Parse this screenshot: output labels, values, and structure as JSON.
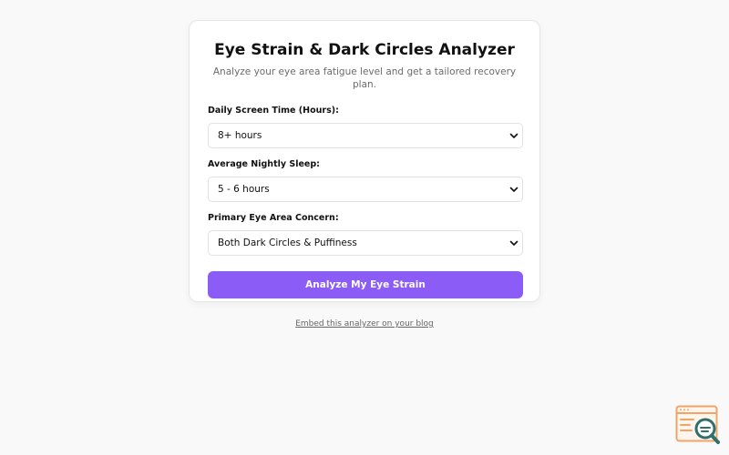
{
  "card": {
    "title": "Eye Strain & Dark Circles Analyzer",
    "subtitle": "Analyze your eye area fatigue level and get a tailored recovery plan."
  },
  "fields": [
    {
      "label": "Daily Screen Time (Hours):",
      "selected": "8+ hours"
    },
    {
      "label": "Average Nightly Sleep:",
      "selected": "5 - 6 hours"
    },
    {
      "label": "Primary Eye Area Concern:",
      "selected": "Both Dark Circles & Puffiness"
    }
  ],
  "submit_label": "Analyze My Eye Strain",
  "embed_link": "Embed this analyzer on your blog",
  "colors": {
    "accent": "#8b5cf6",
    "background": "#f9f9f9",
    "logo_orange": "#f0a468",
    "logo_teal": "#2f6f6c"
  },
  "icons": {
    "select_chevron": "chevron-down-icon",
    "corner_logo": "search-analytics-logo"
  }
}
